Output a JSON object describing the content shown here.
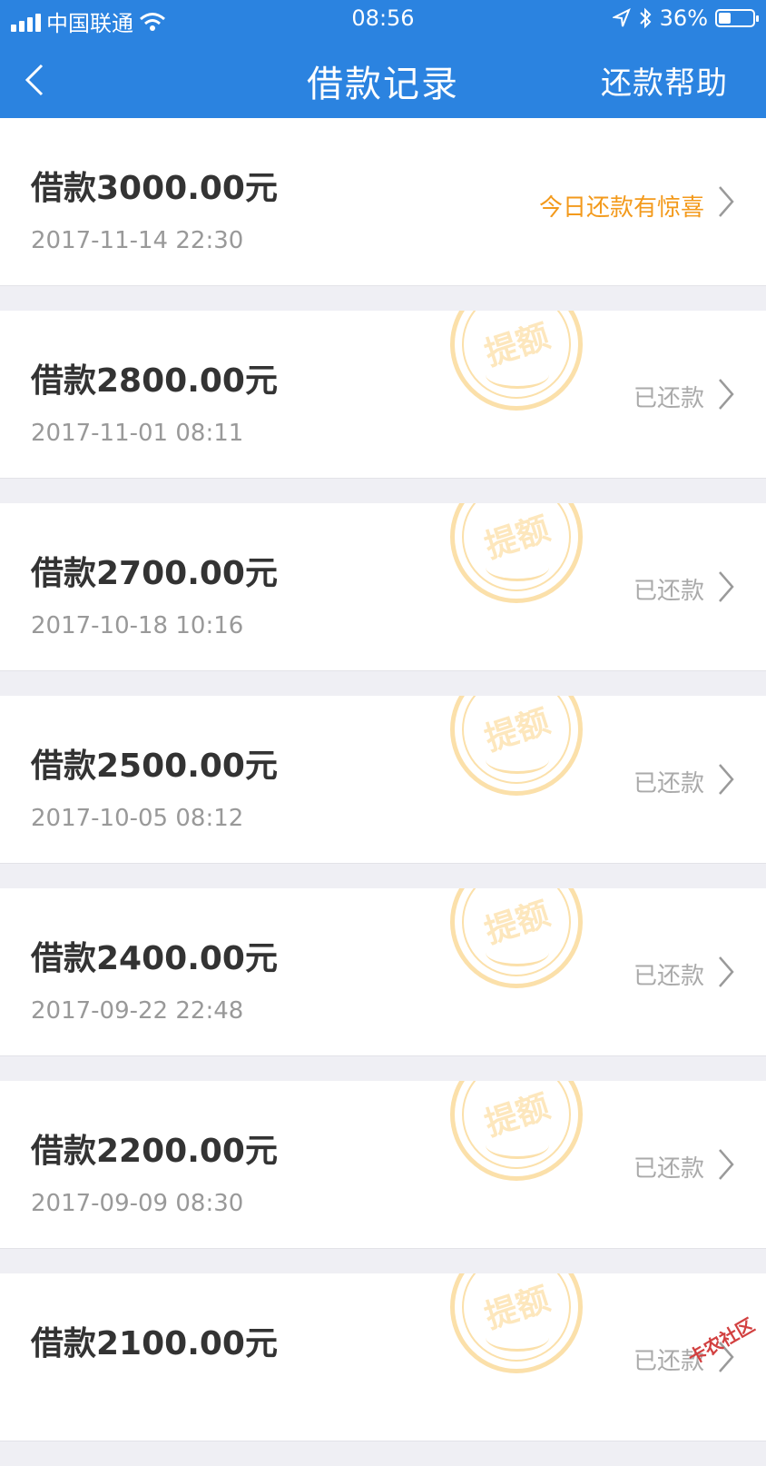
{
  "status_bar": {
    "carrier": "中国联通",
    "time": "08:56",
    "battery_percent": "36%",
    "battery_level": 0.36,
    "icons": [
      "signal-icon",
      "wifi-icon",
      "location-icon",
      "bluetooth-icon",
      "battery-icon"
    ]
  },
  "nav": {
    "title": "借款记录",
    "help_label": "还款帮助",
    "back_icon": "chevron-left-icon"
  },
  "colors": {
    "primary": "#2b83e0",
    "promo": "#f39a1c",
    "status_gray": "#aaaaaa",
    "stamp": "#fbe0aa"
  },
  "stamp_text": "提额",
  "loans": [
    {
      "amount": "借款3000.00元",
      "time": "2017-11-14 22:30",
      "status": "今日还款有惊喜",
      "promo": true,
      "stamp": false
    },
    {
      "amount": "借款2800.00元",
      "time": "2017-11-01 08:11",
      "status": "已还款",
      "promo": false,
      "stamp": true
    },
    {
      "amount": "借款2700.00元",
      "time": "2017-10-18 10:16",
      "status": "已还款",
      "promo": false,
      "stamp": true
    },
    {
      "amount": "借款2500.00元",
      "time": "2017-10-05 08:12",
      "status": "已还款",
      "promo": false,
      "stamp": true
    },
    {
      "amount": "借款2400.00元",
      "time": "2017-09-22 22:48",
      "status": "已还款",
      "promo": false,
      "stamp": true
    },
    {
      "amount": "借款2200.00元",
      "time": "2017-09-09 08:30",
      "status": "已还款",
      "promo": false,
      "stamp": true
    },
    {
      "amount": "借款2100.00元",
      "time": "",
      "status": "已还款",
      "promo": false,
      "stamp": true
    }
  ],
  "watermark": "卡农社区"
}
